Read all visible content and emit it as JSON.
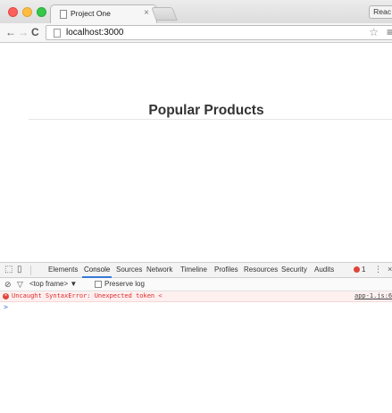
{
  "browser": {
    "tab_title": "Project One",
    "tab_close": "×",
    "profile_button": "Reac",
    "url": "localhost:3000",
    "nav_back": "←",
    "nav_forward": "→",
    "nav_reload": "C",
    "star": "☆",
    "menu": "≡"
  },
  "page": {
    "title": "Popular Products"
  },
  "devtools": {
    "tabs": [
      "Elements",
      "Console",
      "Sources",
      "Network",
      "Timeline",
      "Profiles",
      "Resources",
      "Security",
      "Audits"
    ],
    "active_tab": "Console",
    "error_count": "1",
    "frame_select": "<top frame> ▼",
    "preserve_log": "Preserve log",
    "error_message": "Uncaught SyntaxError: Unexpected token <",
    "error_source": "app-1.js:6",
    "prompt": ">",
    "menu": "⋮",
    "close": "×"
  },
  "colors": {
    "error": "#e02a2a",
    "accent": "#3879d9"
  }
}
